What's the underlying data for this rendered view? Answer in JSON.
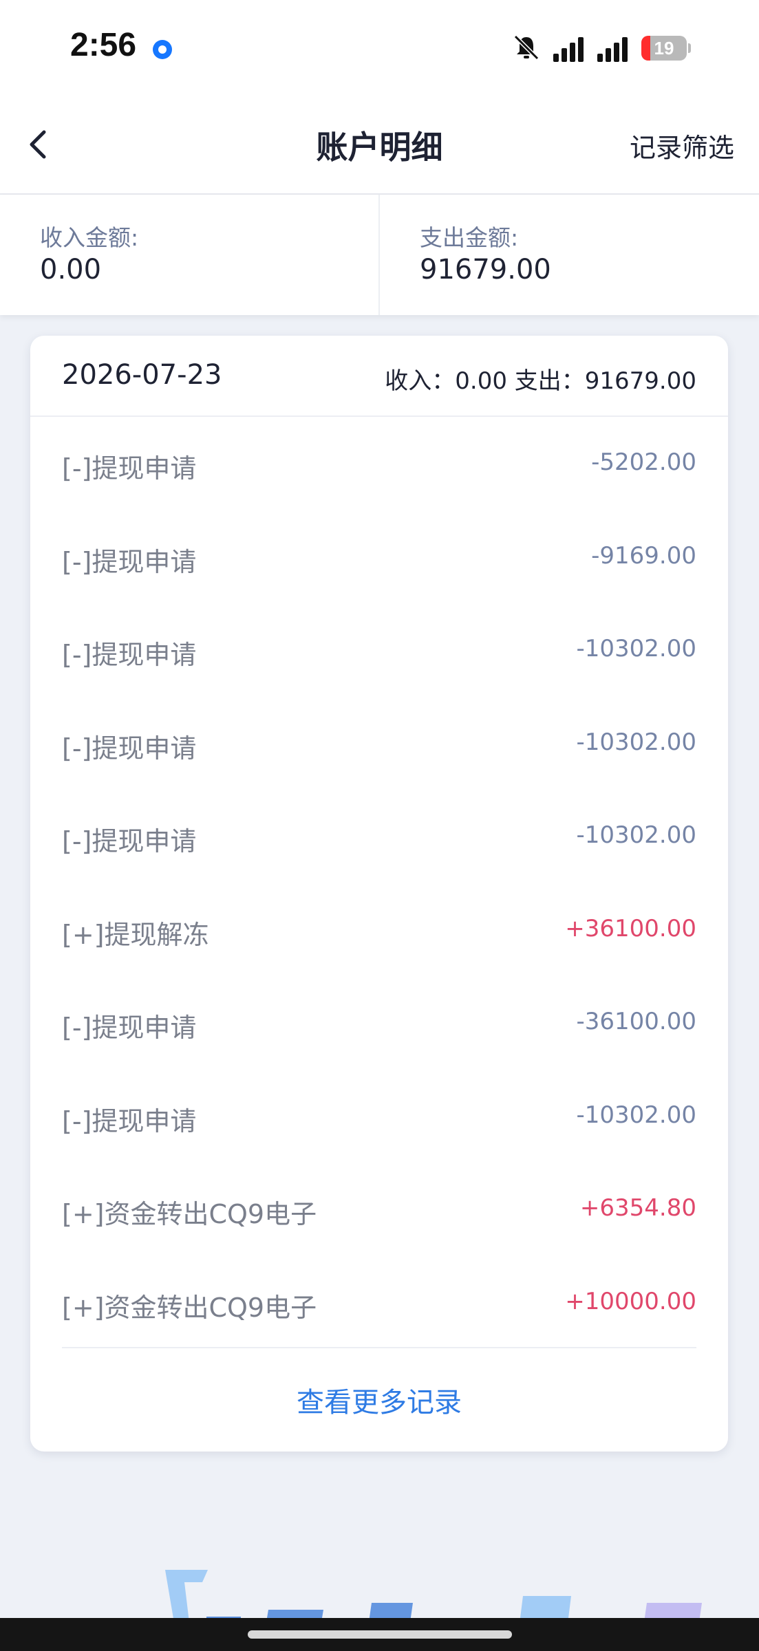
{
  "status_bar": {
    "time": "2:56",
    "battery": "19",
    "battery_level": 0.19
  },
  "nav": {
    "title": "账户明细",
    "filter_label": "记录筛选"
  },
  "summary": {
    "income_label": "收入金额:",
    "income_value": "0.00",
    "expense_label": "支出金额:",
    "expense_value": "91679.00"
  },
  "card": {
    "date": "2026-07-23",
    "totals": "收入：0.00 支出：91679.00",
    "rows": [
      {
        "label": "[-]提现申请",
        "amount": "-5202.00",
        "type": "neg"
      },
      {
        "label": "[-]提现申请",
        "amount": "-9169.00",
        "type": "neg"
      },
      {
        "label": "[-]提现申请",
        "amount": "-10302.00",
        "type": "neg"
      },
      {
        "label": "[-]提现申请",
        "amount": "-10302.00",
        "type": "neg"
      },
      {
        "label": "[-]提现申请",
        "amount": "-10302.00",
        "type": "neg"
      },
      {
        "label": "[+]提现解冻",
        "amount": "+36100.00",
        "type": "pos"
      },
      {
        "label": "[-]提现申请",
        "amount": "-36100.00",
        "type": "neg"
      },
      {
        "label": "[-]提现申请",
        "amount": "-10302.00",
        "type": "neg"
      },
      {
        "label": "[+]资金转出CQ9电子",
        "amount": "+6354.80",
        "type": "pos"
      },
      {
        "label": "[+]资金转出CQ9电子",
        "amount": "+10000.00",
        "type": "pos"
      }
    ],
    "more_label": "查看更多记录"
  },
  "colors": {
    "negative": "#7584a6",
    "positive": "#e0476b",
    "link": "#2e7be4",
    "background": "#eef1f7"
  }
}
